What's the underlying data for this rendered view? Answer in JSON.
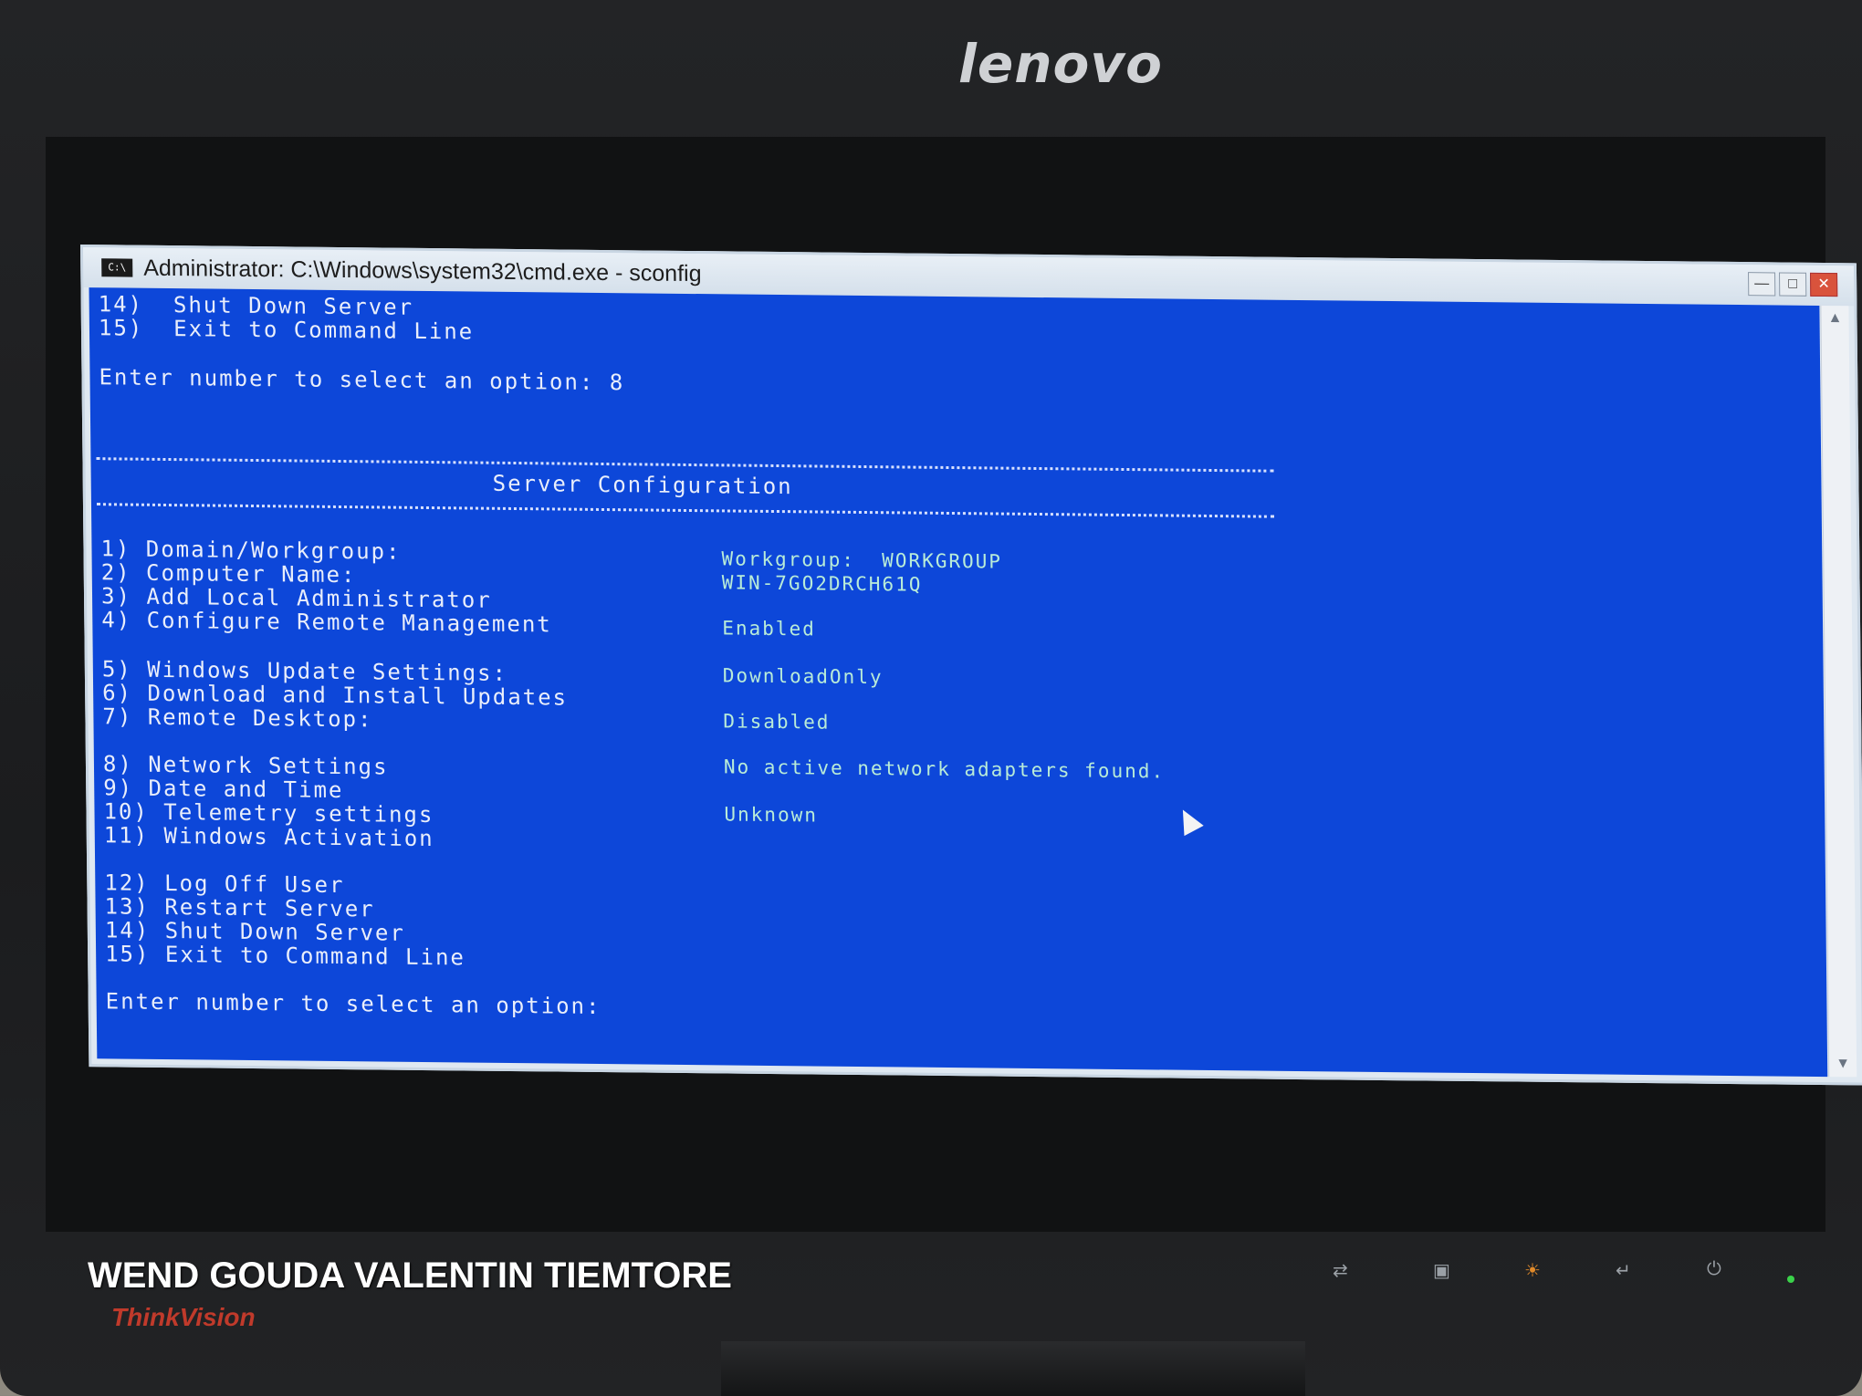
{
  "monitor": {
    "brand": "lenovo",
    "sub_brand": "ThinkVision"
  },
  "window": {
    "title": "Administrator: C:\\Windows\\system32\\cmd.exe - sconfig",
    "icon_text": "C:\\",
    "controls": {
      "minimize": "—",
      "maximize": "□",
      "close": "✕"
    }
  },
  "console": {
    "top_lines": [
      "14)  Shut Down Server",
      "15)  Exit to Command Line",
      "",
      "Enter number to select an option: 8"
    ],
    "header_rule": "================================================================================",
    "header_title": "Server Configuration",
    "menu": [
      {
        "label": "1) Domain/Workgroup:",
        "value": "Workgroup:  WORKGROUP"
      },
      {
        "label": "2) Computer Name:",
        "value": "WIN-7GO2DRCH61Q"
      },
      {
        "label": "3) Add Local Administrator",
        "value": ""
      },
      {
        "label": "4) Configure Remote Management",
        "value": "Enabled"
      },
      {
        "label": "5) Windows Update Settings:",
        "value": "DownloadOnly"
      },
      {
        "label": "6) Download and Install Updates",
        "value": ""
      },
      {
        "label": "7) Remote Desktop:",
        "value": "Disabled"
      },
      {
        "label": "8) Network Settings",
        "value": "No active network adapters found."
      },
      {
        "label": "9) Date and Time",
        "value": ""
      },
      {
        "label": "10) Telemetry settings",
        "value": "Unknown"
      },
      {
        "label": "11) Windows Activation",
        "value": ""
      },
      {
        "label": "12) Log Off User",
        "value": ""
      },
      {
        "label": "13) Restart Server",
        "value": ""
      },
      {
        "label": "14) Shut Down Server",
        "value": ""
      },
      {
        "label": "15) Exit to Command Line",
        "value": ""
      }
    ],
    "prompt": "Enter number to select an option:"
  },
  "watermark": "WEND GOUDA VALENTIN TIEMTORE",
  "colors": {
    "console_bg": "#0d47d9",
    "console_text": "#e9eefb",
    "value_text": "#b9ecd8",
    "titlebar": "#dfe8f1"
  }
}
